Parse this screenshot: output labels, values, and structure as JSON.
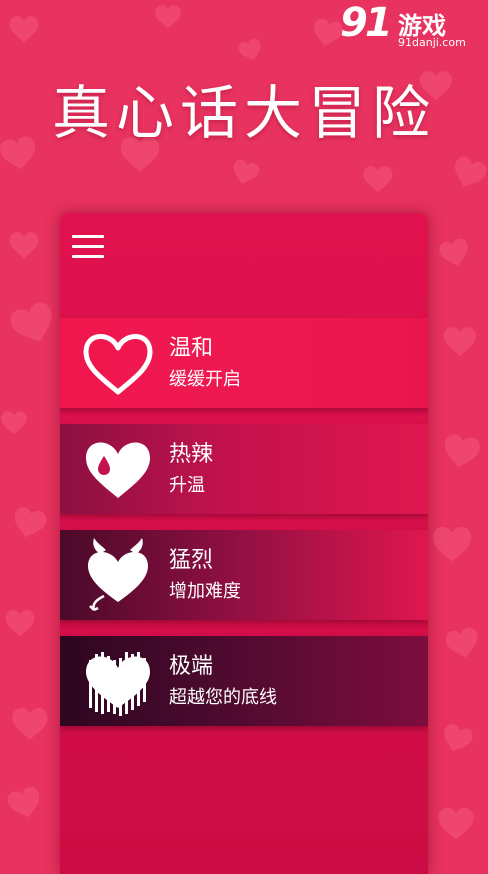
{
  "app": {
    "title": "真心话大冒险"
  },
  "watermark": {
    "number": "91",
    "text": "游戏",
    "url": "91danji.com"
  },
  "menu": {
    "icon": "hamburger-menu-icon"
  },
  "levels": [
    {
      "name": "温和",
      "description": "缓缓开启",
      "icon": "heart-outline-icon",
      "color": "#ee1850"
    },
    {
      "name": "热辣",
      "description": "升温",
      "icon": "heart-drop-icon",
      "color": "#d01452"
    },
    {
      "name": "猛烈",
      "description": "增加难度",
      "icon": "devil-heart-icon",
      "color": "#a51048"
    },
    {
      "name": "极端",
      "description": "超越您的底线",
      "icon": "heart-spikes-icon",
      "color": "#5e0a2e"
    }
  ],
  "colors": {
    "background": "#e8325f",
    "panel": "#dc114c",
    "text": "#ffffff"
  }
}
